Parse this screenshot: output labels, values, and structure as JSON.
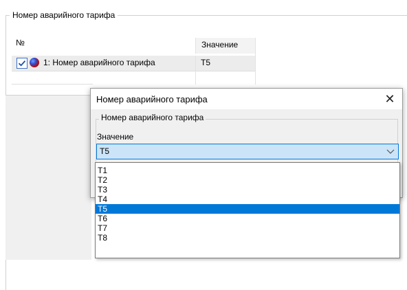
{
  "group": {
    "title": "Номер аварийного тарифа"
  },
  "table": {
    "columns": [
      "№",
      "Значение"
    ],
    "rows": [
      {
        "checked": true,
        "label": "1: Номер аварийного тарифа",
        "value": "T5"
      }
    ]
  },
  "dialog": {
    "title": "Номер аварийного тарифа",
    "close_glyph": "✕",
    "group_title": "Номер аварийного тарифа",
    "field_label": "Значение",
    "selected_value": "T5",
    "options": [
      "T1",
      "T2",
      "T3",
      "T4",
      "T5",
      "T6",
      "T7",
      "T8"
    ],
    "selected_index": 4
  },
  "colors": {
    "accent": "#0078d7",
    "combo_bg": "#cce4f7",
    "dialog_bg": "#f0f0f0"
  }
}
